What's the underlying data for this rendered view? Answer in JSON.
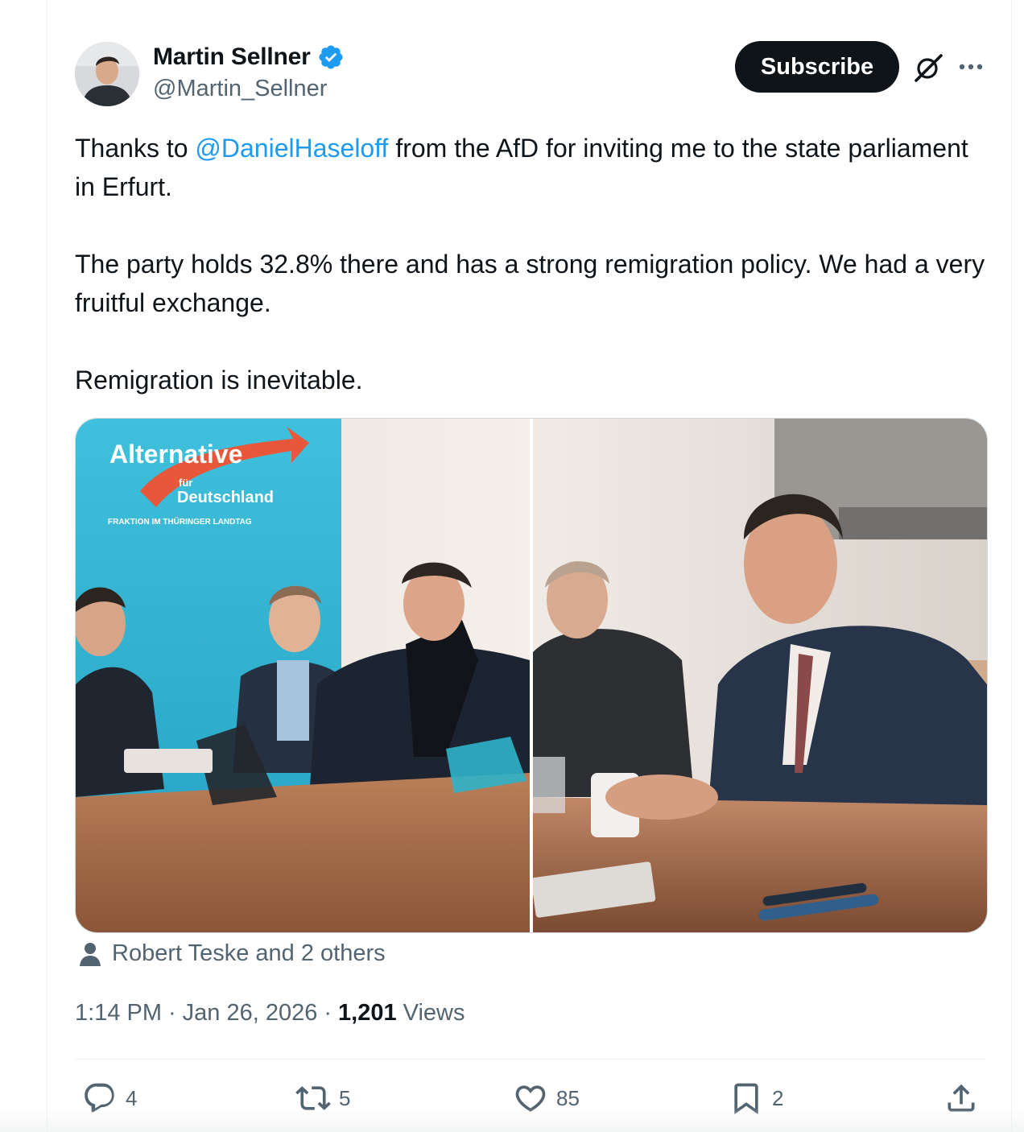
{
  "author": {
    "display_name": "Martin Sellner",
    "handle": "@Martin_Sellner",
    "verified": true
  },
  "header": {
    "subscribe_label": "Subscribe"
  },
  "tweet": {
    "line1_prefix": "Thanks to ",
    "mention": "@DanielHaseloff",
    "line1_suffix": " from the AfD for inviting me to the state parliament in Erfurt.",
    "paragraph2": "The party holds 32.8% there and has a strong remigration policy. We had a very fruitful exchange.",
    "paragraph3": "Remigration is inevitable."
  },
  "media": {
    "photo1_banner_line1": "Alternative",
    "photo1_banner_line2": "für",
    "photo1_banner_line3": "Deutschland",
    "photo1_banner_line4": "FRAKTION IM THÜRINGER LANDTAG"
  },
  "tagged": {
    "text": "Robert Teske and 2 others"
  },
  "meta": {
    "time": "1:14 PM",
    "separator": "·",
    "date": "Jan 26, 2026",
    "views_count": "1,201",
    "views_label": "Views"
  },
  "actions": {
    "replies": "4",
    "reposts": "5",
    "likes": "85",
    "bookmarks": "2"
  },
  "colors": {
    "accent": "#1d9bf0",
    "text_primary": "#0f1419",
    "text_secondary": "#536471",
    "border": "#cfd9de"
  }
}
